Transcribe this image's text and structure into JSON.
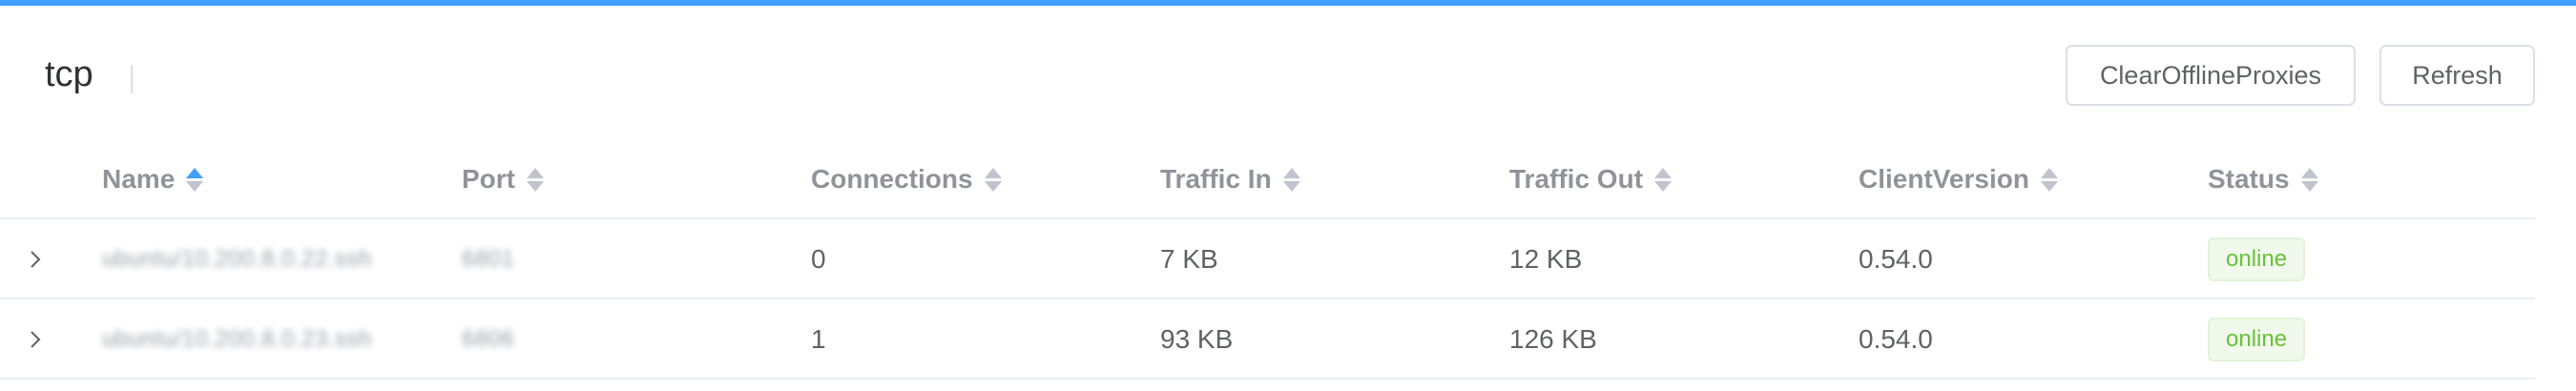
{
  "accent_color": "#409eff",
  "header": {
    "title": "tcp",
    "clear_button_label": "ClearOfflineProxies",
    "refresh_button_label": "Refresh"
  },
  "table": {
    "columns": {
      "name": "Name",
      "port": "Port",
      "connections": "Connections",
      "traffic_in": "Traffic In",
      "traffic_out": "Traffic Out",
      "client_version": "ClientVersion",
      "status": "Status"
    },
    "sorted_column": "name",
    "rows": [
      {
        "name": "ubuntu/10.200.8.0.22.ssh",
        "port": "6801",
        "connections": "0",
        "traffic_in": "7 KB",
        "traffic_out": "12 KB",
        "client_version": "0.54.0",
        "status": "online"
      },
      {
        "name": "ubuntu/10.200.8.0.23.ssh",
        "port": "6806",
        "connections": "1",
        "traffic_in": "93 KB",
        "traffic_out": "126 KB",
        "client_version": "0.54.0",
        "status": "online"
      }
    ]
  }
}
